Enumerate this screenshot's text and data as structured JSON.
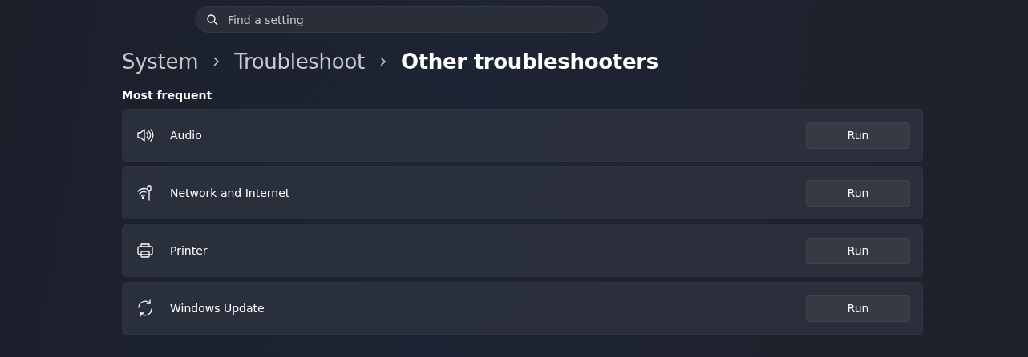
{
  "search": {
    "placeholder": "Find a setting"
  },
  "breadcrumb": [
    {
      "label": "System",
      "selected": false
    },
    {
      "label": "Troubleshoot",
      "selected": false
    },
    {
      "label": "Other troubleshooters",
      "selected": true
    }
  ],
  "section": {
    "title": "Most frequent"
  },
  "troubleshooters": [
    {
      "kind": "audio",
      "label": "Audio",
      "button": "Run"
    },
    {
      "kind": "network",
      "label": "Network and Internet",
      "button": "Run"
    },
    {
      "kind": "printer",
      "label": "Printer",
      "button": "Run"
    },
    {
      "kind": "update",
      "label": "Windows Update",
      "button": "Run"
    }
  ]
}
